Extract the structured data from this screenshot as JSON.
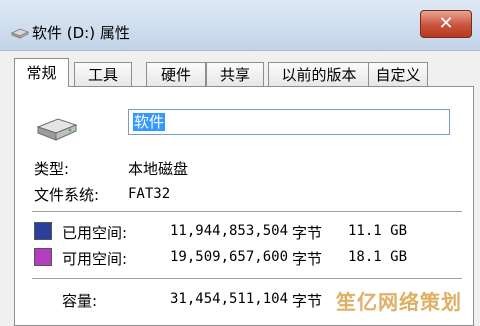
{
  "window": {
    "title": "软件 (D:) 属性",
    "close_glyph": "✕"
  },
  "tabs": [
    {
      "label": "常规",
      "active": true
    },
    {
      "label": "工具",
      "active": false
    },
    {
      "label": "硬件",
      "active": false
    },
    {
      "label": "共享",
      "active": false
    },
    {
      "label": "以前的版本",
      "active": false
    },
    {
      "label": "自定义",
      "active": false
    }
  ],
  "general": {
    "drive_name": "软件",
    "type_label": "类型:",
    "type_value": "本地磁盘",
    "fs_label": "文件系统:",
    "fs_value": "FAT32",
    "used": {
      "label": "已用空间:",
      "bytes": "11,944,853,504",
      "unit": "字节",
      "size": "11.1 GB",
      "color": "#2b3f9e"
    },
    "free": {
      "label": "可用空间:",
      "bytes": "19,509,657,600",
      "unit": "字节",
      "size": "18.1 GB",
      "color": "#b43cc0"
    },
    "capacity": {
      "label": "容量:",
      "bytes": "31,454,511,104",
      "unit": "字节"
    }
  },
  "watermark": "笙亿网络策划",
  "icons": {
    "title": "drive-icon",
    "drive": "hard-drive-icon",
    "close": "close-icon"
  }
}
